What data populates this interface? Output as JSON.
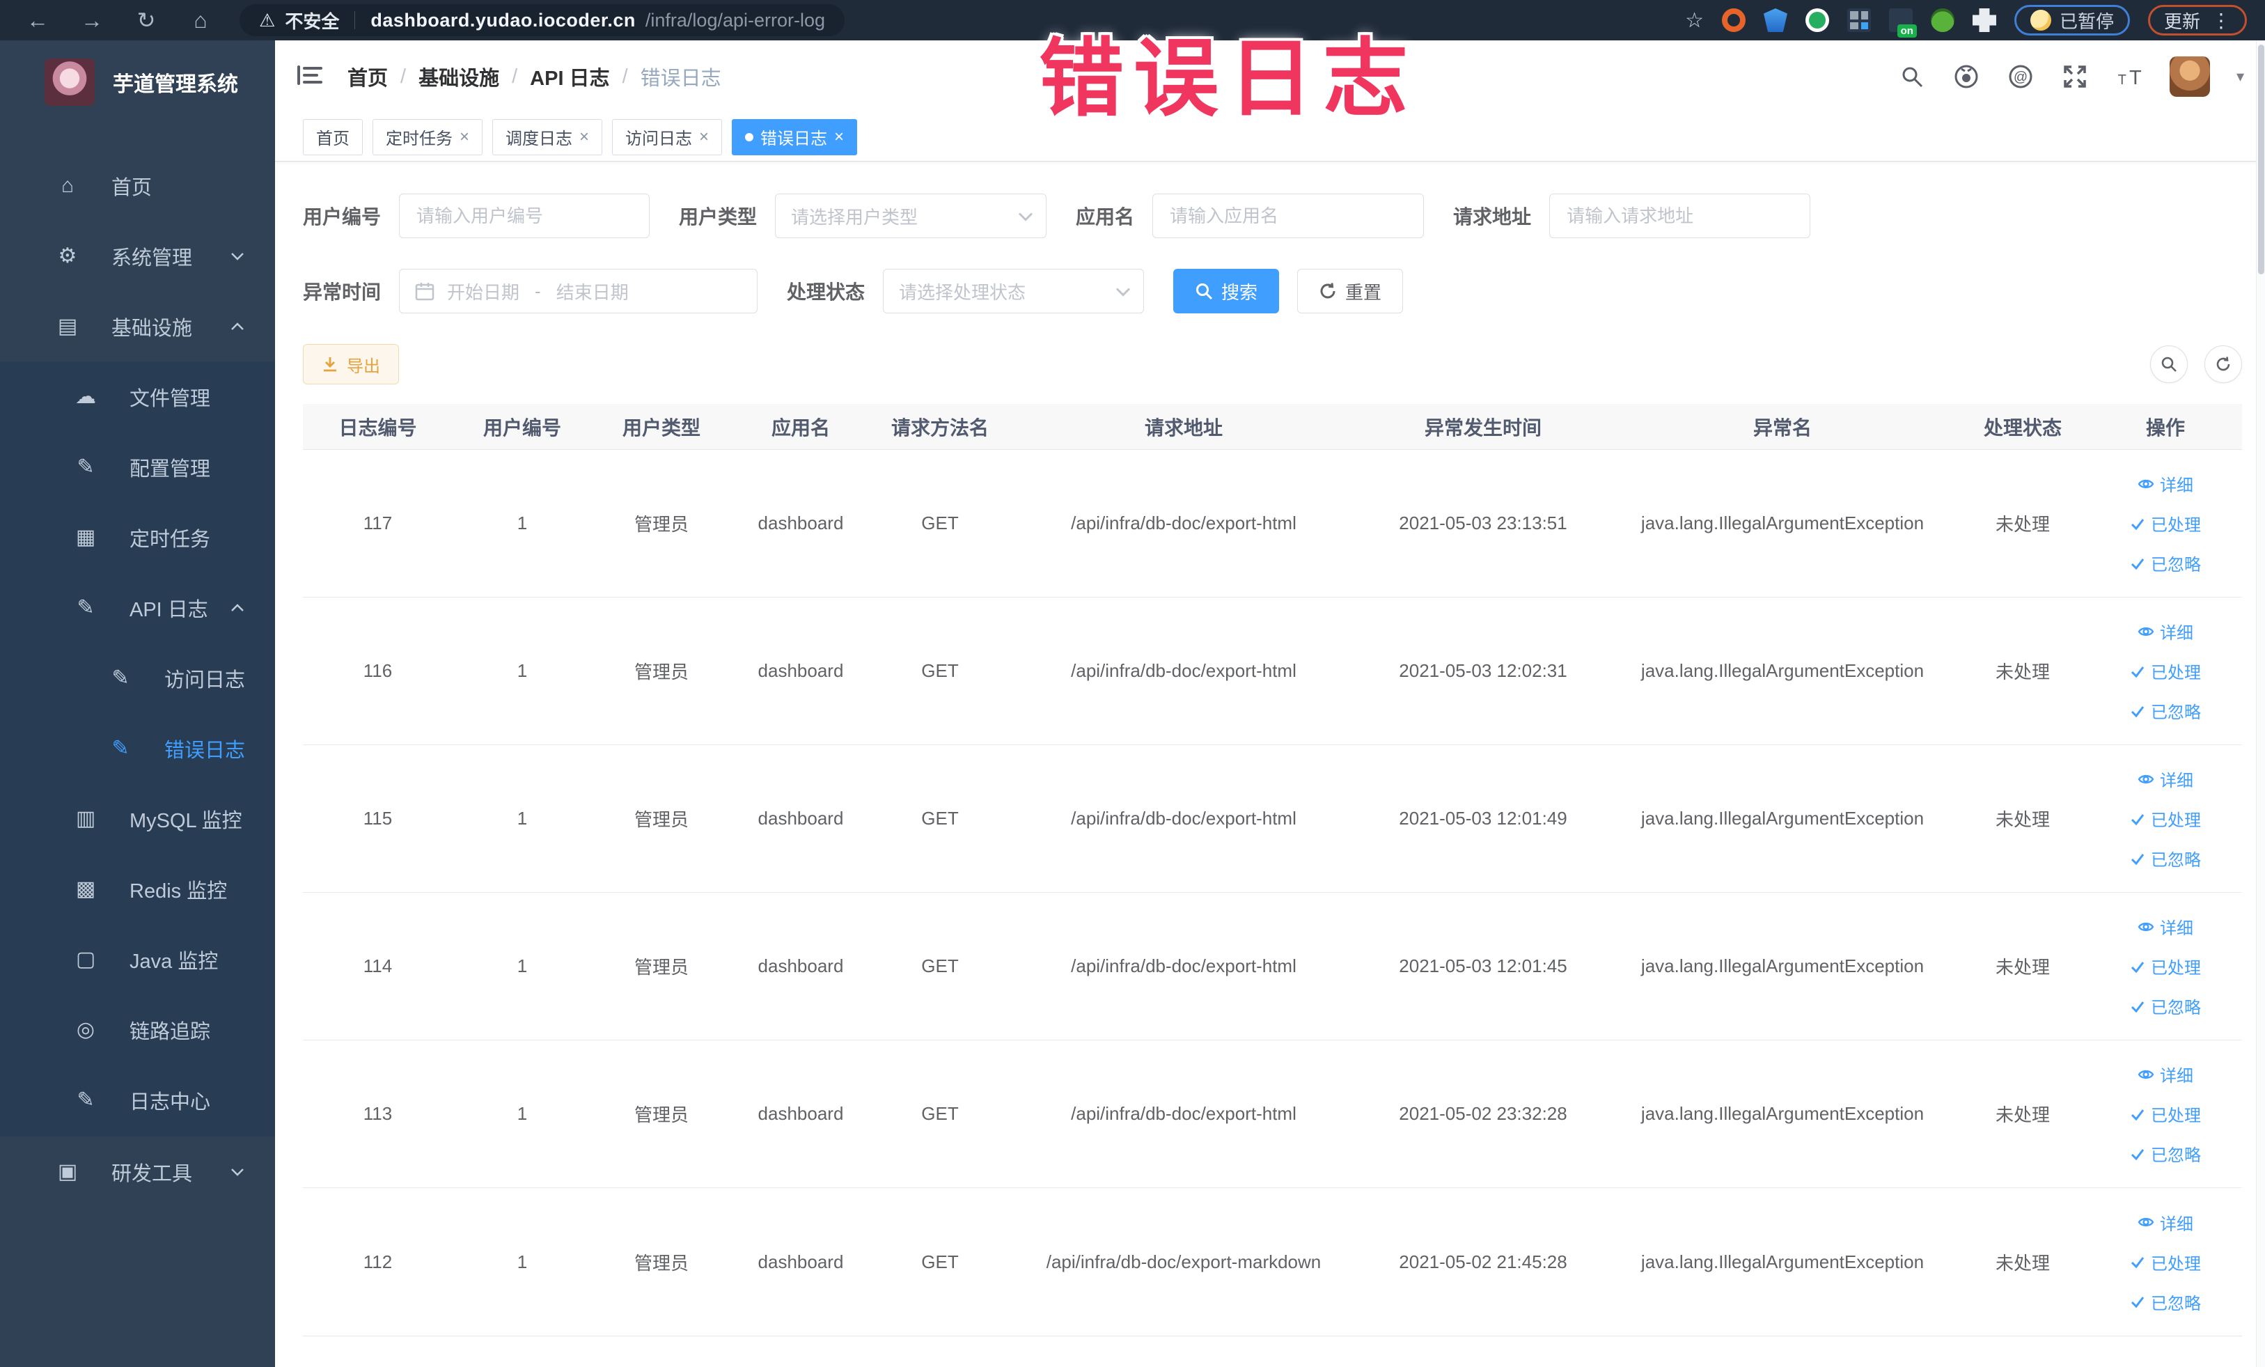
{
  "browser": {
    "security_label": "不安全",
    "url_host": "dashboard.yudao.iocoder.cn",
    "url_path": "/infra/log/api-error-log",
    "paused_badge": "已暂停",
    "update_button": "更新"
  },
  "annotation": {
    "text": "错误日志",
    "color": "#f0365f"
  },
  "sidebar": {
    "title": "芋道管理系统",
    "items": [
      {
        "icon": "home-icon",
        "label": "首页",
        "level": 0,
        "chevron": "",
        "active": false
      },
      {
        "icon": "gear-icon",
        "label": "系统管理",
        "level": 0,
        "chevron": "down",
        "active": false
      },
      {
        "icon": "infra-icon",
        "label": "基础设施",
        "level": 0,
        "chevron": "up",
        "active": false
      },
      {
        "icon": "file-icon",
        "label": "文件管理",
        "level": 1,
        "chevron": "",
        "active": false
      },
      {
        "icon": "config-icon",
        "label": "配置管理",
        "level": 1,
        "chevron": "",
        "active": false
      },
      {
        "icon": "job-icon",
        "label": "定时任务",
        "level": 1,
        "chevron": "",
        "active": false
      },
      {
        "icon": "api-log-icon",
        "label": "API 日志",
        "level": 1,
        "chevron": "up",
        "active": false
      },
      {
        "icon": "access-log-icon",
        "label": "访问日志",
        "level": 2,
        "chevron": "",
        "active": false
      },
      {
        "icon": "error-log-icon",
        "label": "错误日志",
        "level": 2,
        "chevron": "",
        "active": true
      },
      {
        "icon": "mysql-icon",
        "label": "MySQL 监控",
        "level": 1,
        "chevron": "",
        "active": false
      },
      {
        "icon": "redis-icon",
        "label": "Redis 监控",
        "level": 1,
        "chevron": "",
        "active": false
      },
      {
        "icon": "java-icon",
        "label": "Java 监控",
        "level": 1,
        "chevron": "",
        "active": false
      },
      {
        "icon": "trace-icon",
        "label": "链路追踪",
        "level": 1,
        "chevron": "",
        "active": false
      },
      {
        "icon": "log-center-icon",
        "label": "日志中心",
        "level": 1,
        "chevron": "",
        "active": false
      },
      {
        "icon": "devtools-icon",
        "label": "研发工具",
        "level": 0,
        "chevron": "down",
        "active": false
      }
    ]
  },
  "header": {
    "breadcrumb": [
      "首页",
      "基础设施",
      "API 日志",
      "错误日志"
    ]
  },
  "tags": [
    {
      "label": "首页",
      "closable": false,
      "active": false
    },
    {
      "label": "定时任务",
      "closable": true,
      "active": false
    },
    {
      "label": "调度日志",
      "closable": true,
      "active": false
    },
    {
      "label": "访问日志",
      "closable": true,
      "active": false
    },
    {
      "label": "错误日志",
      "closable": true,
      "active": true
    }
  ],
  "filters": {
    "user_id": {
      "label": "用户编号",
      "placeholder": "请输入用户编号"
    },
    "user_type": {
      "label": "用户类型",
      "placeholder": "请选择用户类型"
    },
    "app_name": {
      "label": "应用名",
      "placeholder": "请输入应用名"
    },
    "request_url": {
      "label": "请求地址",
      "placeholder": "请输入请求地址"
    },
    "exception_time": {
      "label": "异常时间",
      "start_placeholder": "开始日期",
      "separator": "-",
      "end_placeholder": "结束日期"
    },
    "process_status": {
      "label": "处理状态",
      "placeholder": "请选择处理状态"
    },
    "search_button": "搜索",
    "reset_button": "重置"
  },
  "toolbar": {
    "export_button": "导出"
  },
  "table": {
    "columns": [
      "日志编号",
      "用户编号",
      "用户类型",
      "应用名",
      "请求方法名",
      "请求地址",
      "异常发生时间",
      "异常名",
      "处理状态",
      "操作"
    ],
    "actions": [
      "详细",
      "已处理",
      "已忽略"
    ],
    "rows": [
      {
        "id": "117",
        "user_id": "1",
        "user_type": "管理员",
        "app": "dashboard",
        "method": "GET",
        "url": "/api/infra/db-doc/export-html",
        "time": "2021-05-03 23:13:51",
        "exception": "java.lang.IllegalArgumentException",
        "status": "未处理"
      },
      {
        "id": "116",
        "user_id": "1",
        "user_type": "管理员",
        "app": "dashboard",
        "method": "GET",
        "url": "/api/infra/db-doc/export-html",
        "time": "2021-05-03 12:02:31",
        "exception": "java.lang.IllegalArgumentException",
        "status": "未处理"
      },
      {
        "id": "115",
        "user_id": "1",
        "user_type": "管理员",
        "app": "dashboard",
        "method": "GET",
        "url": "/api/infra/db-doc/export-html",
        "time": "2021-05-03 12:01:49",
        "exception": "java.lang.IllegalArgumentException",
        "status": "未处理"
      },
      {
        "id": "114",
        "user_id": "1",
        "user_type": "管理员",
        "app": "dashboard",
        "method": "GET",
        "url": "/api/infra/db-doc/export-html",
        "time": "2021-05-03 12:01:45",
        "exception": "java.lang.IllegalArgumentException",
        "status": "未处理"
      },
      {
        "id": "113",
        "user_id": "1",
        "user_type": "管理员",
        "app": "dashboard",
        "method": "GET",
        "url": "/api/infra/db-doc/export-html",
        "time": "2021-05-02 23:32:28",
        "exception": "java.lang.IllegalArgumentException",
        "status": "未处理"
      },
      {
        "id": "112",
        "user_id": "1",
        "user_type": "管理员",
        "app": "dashboard",
        "method": "GET",
        "url": "/api/infra/db-doc/export-markdown",
        "time": "2021-05-02 21:45:28",
        "exception": "java.lang.IllegalArgumentException",
        "status": "未处理"
      }
    ]
  },
  "colors": {
    "accent": "#409eff",
    "warning": "#e6a23c",
    "sidebar_bg": "#304156",
    "submenu_bg": "#283c54",
    "table_header_bg": "#f8f8f9",
    "annotation": "#f0365f"
  }
}
